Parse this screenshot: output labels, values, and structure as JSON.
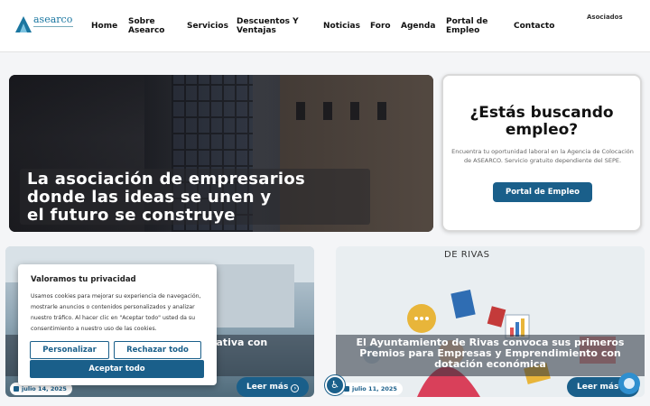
{
  "logo": {
    "text": "asearco"
  },
  "nav": {
    "home": "Home",
    "sobre": "Sobre Asearco",
    "servicios": "Servicios",
    "descuentos": "Descuentos Y Ventajas",
    "noticias": "Noticias",
    "foro": "Foro",
    "agenda": "Agenda",
    "portal": "Portal de Empleo",
    "contacto": "Contacto",
    "asociados": "Asociados"
  },
  "hero": {
    "title_line1": "La asociación de empresarios",
    "title_line2": "donde las ideas se unen y",
    "title_line3": "el futuro se construye"
  },
  "job_card": {
    "title": "¿Estás buscando empleo?",
    "text": "Encuentra tu oportunidad laboral en la Agencia de Colocación de ASEARCO. Servicio gratuito dependiente del SEPE.",
    "button": "Portal de Empleo"
  },
  "news": [
    {
      "title": "E... laboración para c... orporativa con",
      "date": "julio 14, 2025",
      "more": "Leer más"
    },
    {
      "image_text": "DE RIVAS",
      "title": "El Ayuntamiento de Rivas convoca sus primeros Premios para Empresas y Emprendimiento con dotación económica",
      "date": "julio 11, 2025",
      "more": "Leer más"
    }
  ],
  "cookie": {
    "title": "Valoramos tu privacidad",
    "text": "Usamos cookies para mejorar su experiencia de navegación, mostrarle anuncios o contenidos personalizados y analizar nuestro tráfico. Al hacer clic en \"Aceptar todo\" usted da su consentimiento a nuestro uso de las cookies.",
    "customize": "Personalizar",
    "reject": "Rechazar todo",
    "accept": "Aceptar todo"
  },
  "colors": {
    "brand": "#1a5f8a",
    "accent": "#2f8fcf"
  },
  "icons": [
    "calendar-icon",
    "arrow-right-circle-icon",
    "accessibility-icon",
    "chat-icon"
  ]
}
